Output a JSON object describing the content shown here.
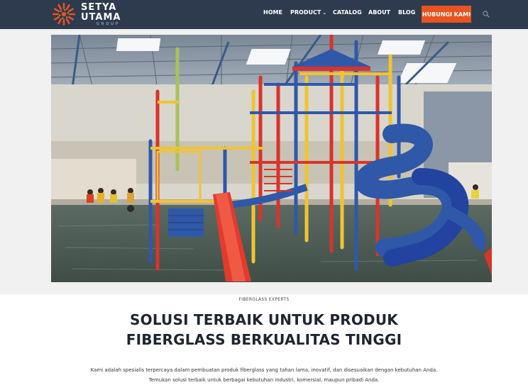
{
  "brand": {
    "line1": "SETYA",
    "line2": "UTAMA",
    "line3": "GROUP",
    "accent": "#e8531f",
    "header_bg": "#2e3b4e"
  },
  "nav": {
    "items": [
      {
        "label": "HOME"
      },
      {
        "label": "PRODUCT"
      },
      {
        "label": "CATALOG"
      },
      {
        "label": "ABOUT"
      },
      {
        "label": "BLOG"
      }
    ],
    "product_caret": "⌄",
    "cta_label": "HUBUNGI KAMI",
    "search_icon": "search-icon"
  },
  "hero": {
    "image": "indoor water park playground with red, yellow and blue slides in a pool"
  },
  "content": {
    "eyebrow": "FIBERGLASS EXPERTS",
    "headline_line1": "SOLUSI TERBAIK UNTUK PRODUK",
    "headline_line2": "FIBERGLASS BERKUALITAS TINGGI",
    "desc_line1": "Kami adalah spesialis terpercaya dalam pembuatan produk fiberglass yang tahan lama, inovatif, dan disesuaikan dengan kebutuhan Anda.",
    "desc_line2": "Temukan solusi terbaik untuk berbagai kebutuhan industri, komersial, maupun pribadi Anda."
  }
}
